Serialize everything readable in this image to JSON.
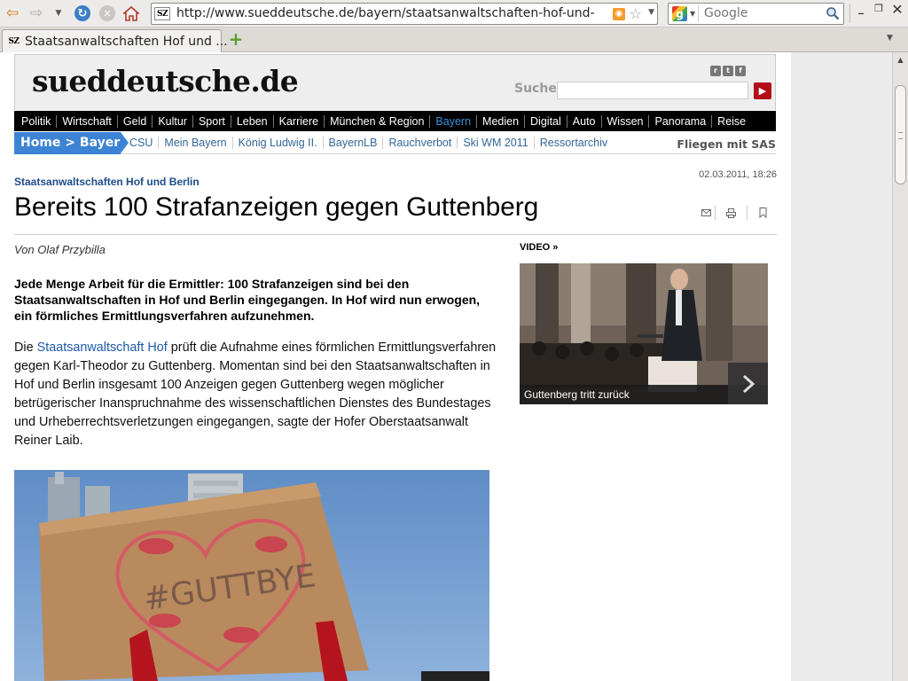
{
  "browser": {
    "url": "http://www.sueddeutsche.de/bayern/staatsanwaltschaften-hof-und-berlin-b",
    "search_placeholder": "Google",
    "tab_title": "Staatsanwaltschaften Hof und ...",
    "favicon_text": "SZ"
  },
  "site": {
    "logo": "sueddeutsche.de",
    "search_label": "Suche",
    "nav": [
      "Politik",
      "Wirtschaft",
      "Geld",
      "Kultur",
      "Sport",
      "Leben",
      "Karriere",
      "München & Region",
      "Bayern",
      "Medien",
      "Digital",
      "Auto",
      "Wissen",
      "Panorama",
      "Reise"
    ],
    "nav_active": "Bayern",
    "subnav_home": "Home > Bayern",
    "subnav": [
      "CSU",
      "Mein Bayern",
      "König Ludwig II.",
      "BayernLB",
      "Rauchverbot",
      "Ski WM 2011",
      "Ressortarchiv"
    ],
    "subnav_right": "Fliegen mit SAS"
  },
  "article": {
    "kicker": "Staatsanwaltschaften Hof und Berlin",
    "date": "02.03.2011, 18:26",
    "headline": "Bereits 100 Strafanzeigen gegen Guttenberg",
    "byline": "Von Olaf Przybilla",
    "lead": "Jede Menge Arbeit für die Ermittler: 100 Strafanzeigen sind bei den Staatsanwaltschaften in Hof und Berlin eingegangen. In Hof wird nun erwogen, ein förmliches Ermittlungsverfahren aufzunehmen.",
    "body_prefix": "Die ",
    "body_link": "Staatsanwaltschaft Hof",
    "body_rest": " prüft die Aufnahme eines förmlichen Ermittlungsverfahren gegen Karl-Theodor zu Guttenberg. Momentan sind bei den Staatsanwaltschaften in Hof und Berlin insgesamt 100 Anzeigen gegen Guttenberg wegen möglicher betrügerischer Inanspruchnahme des wissenschaftlichen Dienstes des Bundestages und Urheberrechtsverletzungen eingegangen, sagte der Hofer Oberstaatsanwalt Reiner Laib.",
    "image_sign_text": "#GUTTBYE"
  },
  "video": {
    "label": "VIDEO »",
    "caption": "Guttenberg tritt zurück"
  },
  "colors": {
    "nav_bg": "#000000",
    "nav_active": "#3c8fdc",
    "link": "#336699",
    "breadcrumb_bg": "#3c83d4",
    "search_button": "#b30d17"
  },
  "icons": {
    "back": "back-arrow-icon",
    "forward": "forward-arrow-icon",
    "reload": "reload-icon",
    "stop": "stop-icon",
    "home": "home-icon",
    "rss": "rss-icon",
    "bookmark": "star-icon",
    "search": "magnifier-icon",
    "new_tab": "plus-icon",
    "mail": "mail-icon",
    "print": "print-icon",
    "bookmark_article": "bookmark-icon",
    "play": "play-icon"
  }
}
